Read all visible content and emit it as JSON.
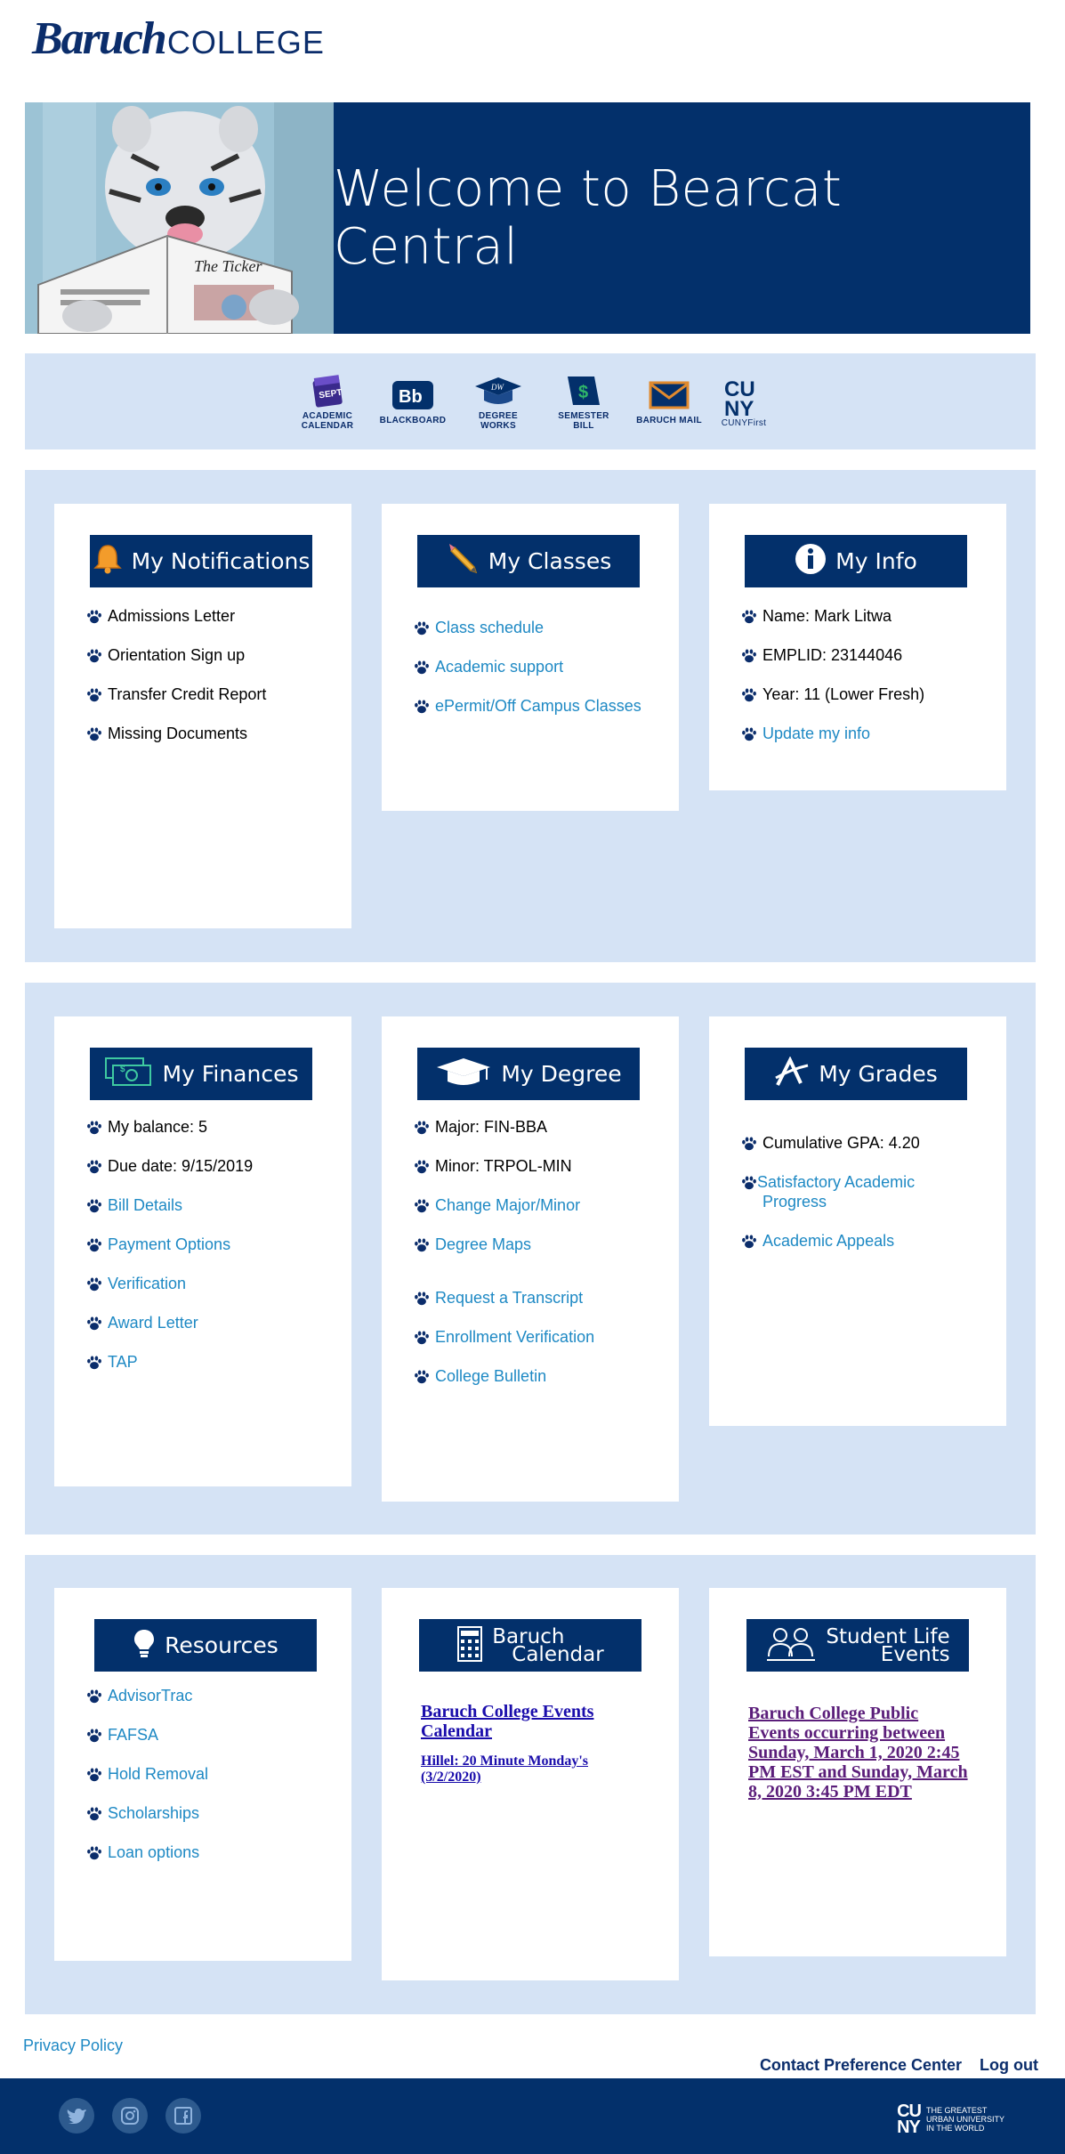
{
  "logo": {
    "part1": "Baruch",
    "part2": "COLLEGE"
  },
  "hero": {
    "title": "Welcome to Bearcat Central",
    "image_caption": "The Ticker"
  },
  "quick_links": [
    {
      "label_line1": "ACADEMIC",
      "label_line2": "CALENDAR",
      "icon": "calendar-icon",
      "icon_text": "SEPT"
    },
    {
      "label_line1": "BLACKBOARD",
      "label_line2": "",
      "icon": "blackboard-icon",
      "icon_text": "Bb"
    },
    {
      "label_line1": "DEGREE WORKS",
      "label_line2": "",
      "icon": "degree-works-icon",
      "icon_text": "DW"
    },
    {
      "label_line1": "SEMESTER BILL",
      "label_line2": "",
      "icon": "semester-bill-icon",
      "icon_text": "$"
    },
    {
      "label_line1": "BARUCH MAIL",
      "label_line2": "",
      "icon": "mail-icon",
      "icon_text": ""
    },
    {
      "label_line1": "CUNYFirst",
      "label_line2": "",
      "icon": "cunyfirst-icon",
      "icon_text": "CUNY"
    }
  ],
  "notifications": {
    "title": "My Notifications",
    "items": [
      "Admissions Letter",
      "Orientation Sign up",
      "Transfer Credit Report",
      "Missing Documents"
    ]
  },
  "classes": {
    "title": "My Classes",
    "items": [
      "Class schedule",
      "Academic support",
      "ePermit/Off Campus Classes"
    ]
  },
  "info": {
    "title": "My Info",
    "name": "Name: Mark Litwa",
    "emplid": "EMPLID: 23144046",
    "year": "Year: 11 (Lower Fresh)",
    "update": "Update my info"
  },
  "finances": {
    "title": "My Finances",
    "balance": "My balance: 5",
    "due_date": "Due date: 9/15/2019",
    "links": [
      "Bill Details",
      "Payment Options",
      "Verification",
      "Award Letter",
      "TAP"
    ]
  },
  "degree": {
    "title": "My Degree",
    "major": "Major: FIN-BBA",
    "minor": "Minor: TRPOL-MIN",
    "links": [
      "Change Major/Minor",
      "Degree Maps"
    ],
    "links2": [
      "Request a Transcript",
      "Enrollment Verification",
      "College Bulletin"
    ]
  },
  "grades": {
    "title": "My Grades",
    "gpa": "Cumulative GPA: 4.20",
    "links": [
      "Satisfactory Academic Progress",
      "Academic Appeals"
    ]
  },
  "resources": {
    "title": "Resources",
    "links": [
      "AdvisorTrac",
      "FAFSA",
      "Hold Removal",
      "Scholarships",
      "Loan options"
    ]
  },
  "calendar": {
    "title_line1": "Baruch",
    "title_line2": "Calendar",
    "main_link": "Baruch College Events Calendar",
    "event_link": "Hillel: 20 Minute Monday's (3/2/2020)"
  },
  "student_life": {
    "title_line1": "Student Life",
    "title_line2": "Events",
    "link": "Baruch College Public Events occurring between Sunday, March 1, 2020 2:45 PM EST and Sunday, March 8, 2020 3:45 PM EDT"
  },
  "footer": {
    "privacy": "Privacy Policy",
    "contact": "Contact Preference Center",
    "logout": "Log out",
    "cuny_mark_line1": "CU",
    "cuny_mark_line2": "NY",
    "cuny_tagline_1": "THE GREATEST",
    "cuny_tagline_2": "URBAN UNIVERSITY",
    "cuny_tagline_3": "IN THE WORLD",
    "social": [
      "twitter-icon",
      "instagram-icon",
      "facebook-icon"
    ]
  },
  "colors": {
    "navy": "#03306b",
    "band": "#d5e3f5",
    "link": "#1e89c4"
  }
}
